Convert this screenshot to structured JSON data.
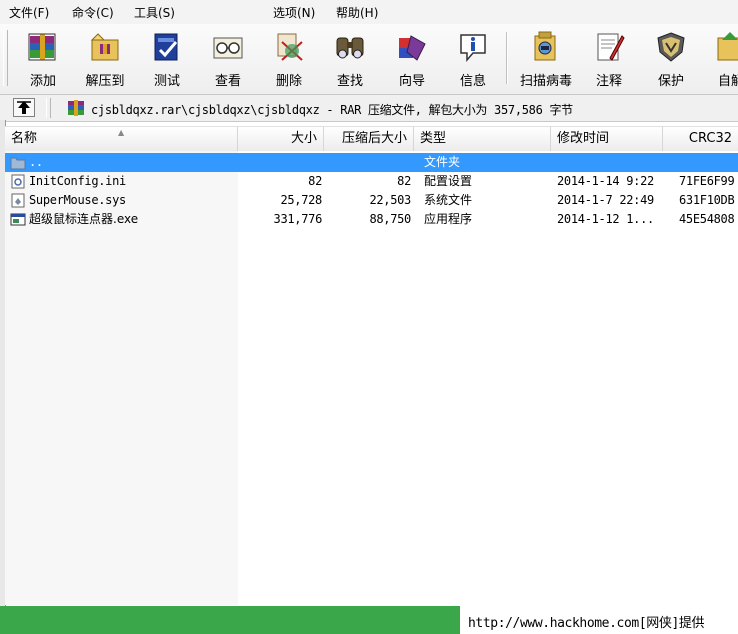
{
  "menubar": {
    "items": [
      "文件(F)",
      "命令(C)",
      "工具(S)",
      "选项(N)",
      "帮助(H)"
    ]
  },
  "toolbar": {
    "buttons": [
      {
        "label": "添加",
        "icon": "add-archive-icon"
      },
      {
        "label": "解压到",
        "icon": "extract-to-icon"
      },
      {
        "label": "测试",
        "icon": "test-icon"
      },
      {
        "label": "查看",
        "icon": "view-icon"
      },
      {
        "label": "删除",
        "icon": "delete-icon"
      },
      {
        "label": "查找",
        "icon": "find-icon"
      },
      {
        "label": "向导",
        "icon": "wizard-icon"
      },
      {
        "label": "信息",
        "icon": "info-icon"
      },
      {
        "label": "扫描病毒",
        "icon": "scan-virus-icon"
      },
      {
        "label": "注释",
        "icon": "comment-icon"
      },
      {
        "label": "保护",
        "icon": "protect-icon"
      },
      {
        "label": "自解",
        "icon": "sfx-icon"
      }
    ]
  },
  "address": {
    "text": "cjsbldqxz.rar\\cjsbldqxz\\cjsbldqxz - RAR 压缩文件, 解包大小为 357,586 字节"
  },
  "columns": [
    "名称",
    "大小",
    "压缩后大小",
    "类型",
    "修改时间",
    "CRC32"
  ],
  "files": [
    {
      "name": "..",
      "size": "",
      "packed": "",
      "type": "文件夹",
      "modified": "",
      "crc": "",
      "icon": "folder-up-icon",
      "selected": true
    },
    {
      "name": "InitConfig.ini",
      "size": "82",
      "packed": "82",
      "type": "配置设置",
      "modified": "2014-1-14 9:22",
      "crc": "71FE6F99",
      "icon": "ini-file-icon",
      "selected": false
    },
    {
      "name": "SuperMouse.sys",
      "size": "25,728",
      "packed": "22,503",
      "type": "系统文件",
      "modified": "2014-1-7 22:49",
      "crc": "631F10DB",
      "icon": "sys-file-icon",
      "selected": false
    },
    {
      "name": "超级鼠标连点器.exe",
      "size": "331,776",
      "packed": "88,750",
      "type": "应用程序",
      "modified": "2014-1-12 1...",
      "crc": "45E54808",
      "icon": "exe-file-icon",
      "selected": false
    }
  ],
  "status": {
    "text": "http://www.hackhome.com[网侠]提供"
  },
  "colors": {
    "selection": "#3399ff",
    "status_green": "#3aa74a"
  }
}
